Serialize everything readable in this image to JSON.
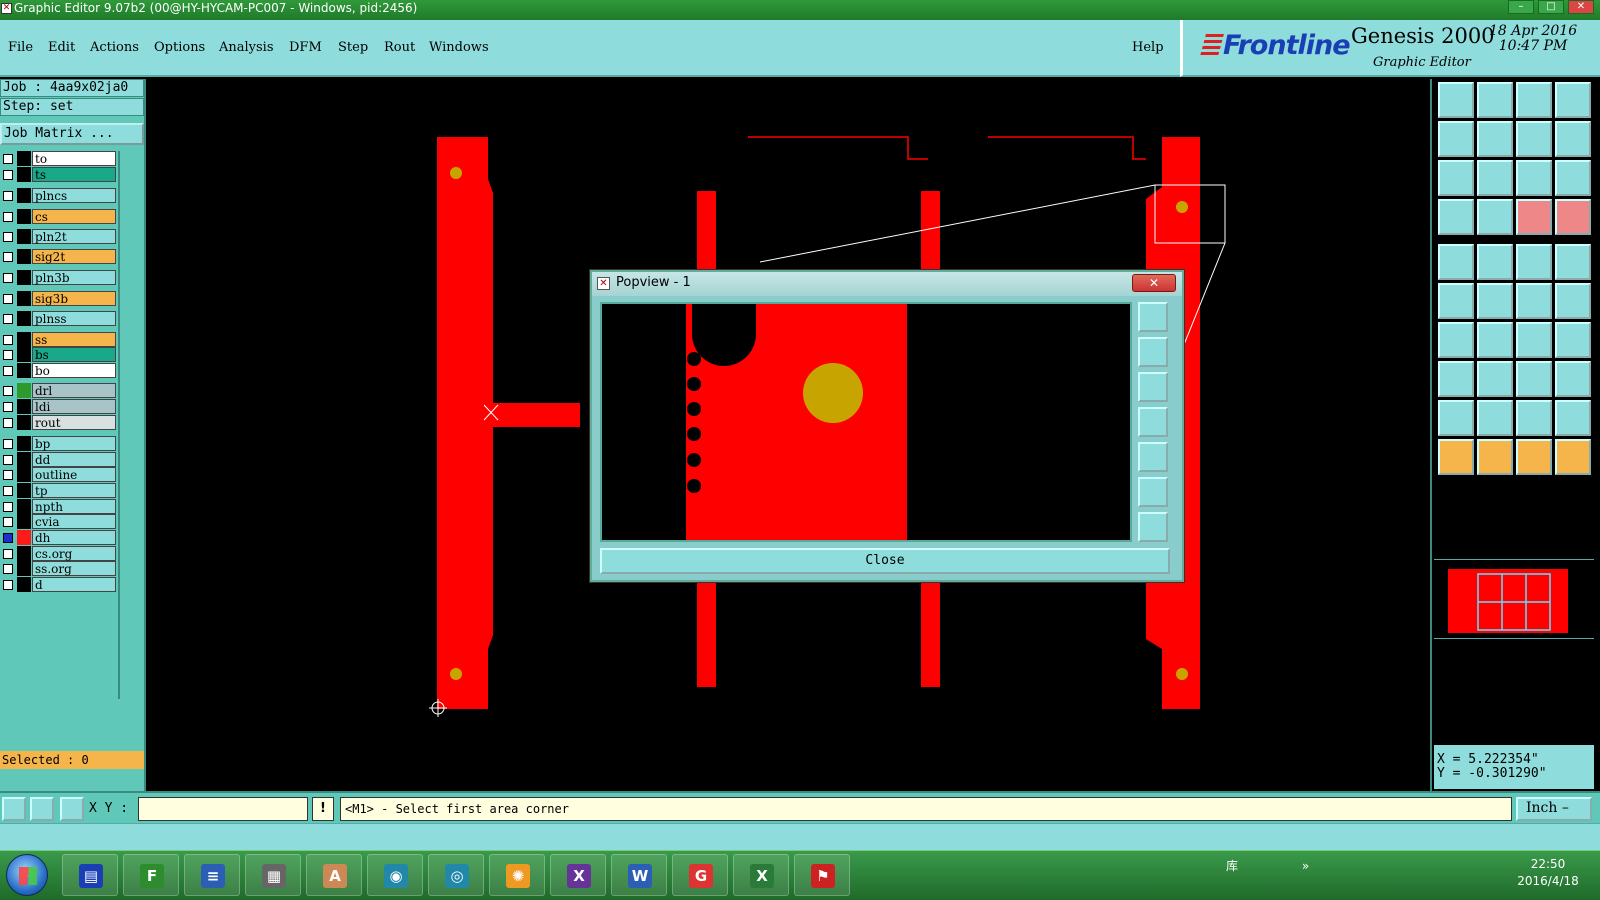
{
  "window": {
    "title": "Graphic Editor 9.07b2 (00@HY-HYCAM-PC007 - Windows, pid:2456)",
    "controls": [
      "–",
      "□",
      "✕"
    ]
  },
  "menu": {
    "items": [
      "File",
      "Edit",
      "Actions",
      "Options",
      "Analysis",
      "DFM",
      "Step",
      "Rout",
      "Windows"
    ],
    "help": "Help"
  },
  "brand": {
    "logo": "Frontline",
    "product": "Genesis 2000",
    "subtitle": "Graphic Editor",
    "date": "18 Apr 2016",
    "time": "10:47 PM"
  },
  "job": {
    "job_label": "Job : 4aa9x02ja0",
    "step_label": "Step: set",
    "matrix_button": "Job Matrix ..."
  },
  "layers": [
    {
      "name": "to",
      "color": "#ffffff",
      "swatch": "#000000",
      "checked": false
    },
    {
      "name": "ts",
      "color": "#1aa88a",
      "swatch": "#000000",
      "checked": false
    },
    {
      "name": "plncs",
      "color": "#8fdcdc",
      "swatch": "#000000",
      "checked": false
    },
    {
      "name": "cs",
      "color": "#f5b54a",
      "swatch": "#000000",
      "checked": false
    },
    {
      "name": "pln2t",
      "color": "#8fdcdc",
      "swatch": "#000000",
      "checked": false
    },
    {
      "name": "sig2t",
      "color": "#f5b54a",
      "swatch": "#000000",
      "checked": false
    },
    {
      "name": "pln3b",
      "color": "#8fdcdc",
      "swatch": "#000000",
      "checked": false
    },
    {
      "name": "sig3b",
      "color": "#f5b54a",
      "swatch": "#000000",
      "checked": false
    },
    {
      "name": "plnss",
      "color": "#8fdcdc",
      "swatch": "#000000",
      "checked": false
    },
    {
      "name": "ss",
      "color": "#f5b54a",
      "swatch": "#000000",
      "checked": false
    },
    {
      "name": "bs",
      "color": "#1aa88a",
      "swatch": "#000000",
      "checked": false
    },
    {
      "name": "bo",
      "color": "#ffffff",
      "swatch": "#000000",
      "checked": false
    },
    {
      "name": "drl",
      "color": "#a9c4c8",
      "swatch": "#2e9a2e",
      "checked": false
    },
    {
      "name": "ldi",
      "color": "#a9c4c8",
      "swatch": "#000000",
      "checked": false
    },
    {
      "name": "rout",
      "color": "#d9e0e0",
      "swatch": "#000000",
      "checked": false
    },
    {
      "name": "bp",
      "color": "#8fdcdc",
      "swatch": "#000000",
      "checked": false
    },
    {
      "name": "dd",
      "color": "#8fdcdc",
      "swatch": "#000000",
      "checked": false
    },
    {
      "name": "outline",
      "color": "#8fdcdc",
      "swatch": "#000000",
      "checked": false
    },
    {
      "name": "tp",
      "color": "#8fdcdc",
      "swatch": "#000000",
      "checked": false
    },
    {
      "name": "npth",
      "color": "#8fdcdc",
      "swatch": "#000000",
      "checked": false
    },
    {
      "name": "cvia",
      "color": "#8fdcdc",
      "swatch": "#000000",
      "checked": false
    },
    {
      "name": "dh",
      "color": "#8fdcdc",
      "swatch": "#ff1a1a",
      "checked": true
    },
    {
      "name": "cs.org",
      "color": "#8fdcdc",
      "swatch": "#000000",
      "checked": false
    },
    {
      "name": "ss.org",
      "color": "#8fdcdc",
      "swatch": "#000000",
      "checked": false
    },
    {
      "name": "d",
      "color": "#8fdcdc",
      "swatch": "#000000",
      "checked": false
    }
  ],
  "selected_label": "Selected : 0",
  "popview": {
    "title": "Popview - 1",
    "close_x": "✕",
    "close_button": "Close"
  },
  "coords": {
    "x": "X = 5.222354\"",
    "y": "Y = -0.301290\""
  },
  "status": {
    "xy_label": "X Y :",
    "xy_value": "",
    "alert": "!",
    "prompt": "<M1> - Select first area corner",
    "units": "Inch"
  },
  "taskbar": {
    "apps": [
      "save-icon",
      "frontline-app-icon",
      "notepad-icon",
      "calculator-icon",
      "paint-icon",
      "genesis-eye-icon",
      "network-icon",
      "shell-icon",
      "x-app-icon",
      "word-icon",
      "app-g-icon",
      "excel-icon",
      "pdf-icon"
    ],
    "tray_label": "库",
    "tray_more": "»",
    "time": "22:50",
    "date": "2016/4/18"
  },
  "colors": {
    "accent": "#8fdcdc",
    "panel": "#5fc8b8",
    "copper": "#ff0000",
    "pad": "#c8a400"
  }
}
